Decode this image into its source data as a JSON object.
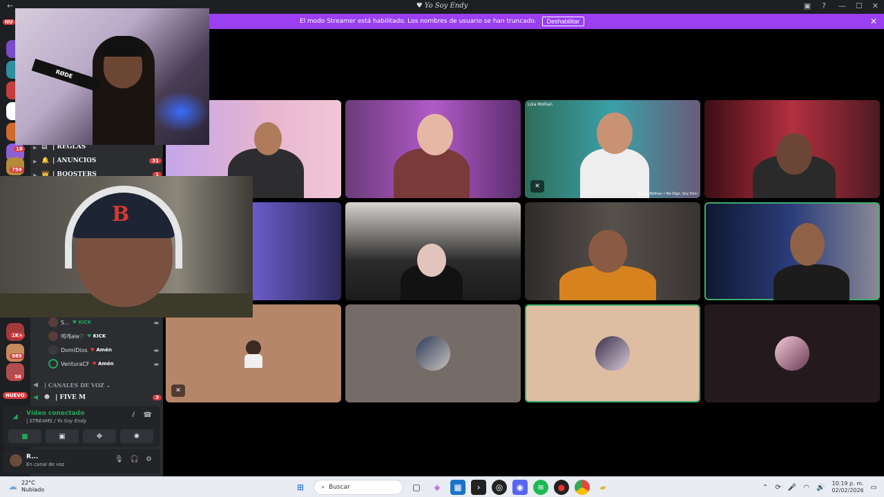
{
  "window": {
    "title": "Yo Soy Endy",
    "back_icon": "←",
    "icons": [
      "inbox-icon",
      "help-icon"
    ],
    "min": "—",
    "max": "☐",
    "close": "✕"
  },
  "banner": {
    "text": "El modo Streamer está habilitado. Los nombres de usuario se han truncado.",
    "button": "Deshabilitar",
    "close": "✕"
  },
  "rail": {
    "top_badge": "NU",
    "badges": [
      {
        "text": "18"
      },
      {
        "text": "759"
      },
      {
        "text": "1K+"
      },
      {
        "text": "989"
      },
      {
        "text": "58"
      }
    ],
    "nuevo": "NUEVO"
  },
  "channels": {
    "rows": [
      {
        "label": "| REGLAS",
        "icon": "▤"
      },
      {
        "label": "| ANUNCIOS",
        "icon": "🔔",
        "count": "31"
      },
      {
        "label": "| BOOSTERS",
        "icon": "👑",
        "count": "1"
      }
    ],
    "voice_category": "| CANALES DE VOZ ⌄",
    "voice_channel": {
      "label": "| FIVE M",
      "count": "3"
    },
    "voice_users": [
      {
        "name": "S...",
        "tag": "KICK",
        "tag_color": "green"
      },
      {
        "name": "에게ale♡",
        "tag": "KICK",
        "tag_color": "green"
      },
      {
        "name": "DomIDios",
        "tag": "Amén",
        "tag_color": "white"
      },
      {
        "name": "VenturaCF",
        "tag": "Amén",
        "tag_color": "white"
      }
    ]
  },
  "voice_panel": {
    "title": "Vídeo conectado",
    "subtitle": "| STREAMS / Yo Soy Endy"
  },
  "user_panel": {
    "name": "R...",
    "status": "En canal de voz"
  },
  "grid": {
    "tile_label_3": "Lola Molhan",
    "tile_caption_3": "@Lola_Molhan • No Digo, Soy Doni"
  },
  "overlay": {
    "mic_brand": "RØDE"
  },
  "taskbar": {
    "temp": "22°C",
    "weather": "Nublado",
    "search": "Buscar",
    "time": "10:19 p. m.",
    "date": "02/02/2026"
  }
}
